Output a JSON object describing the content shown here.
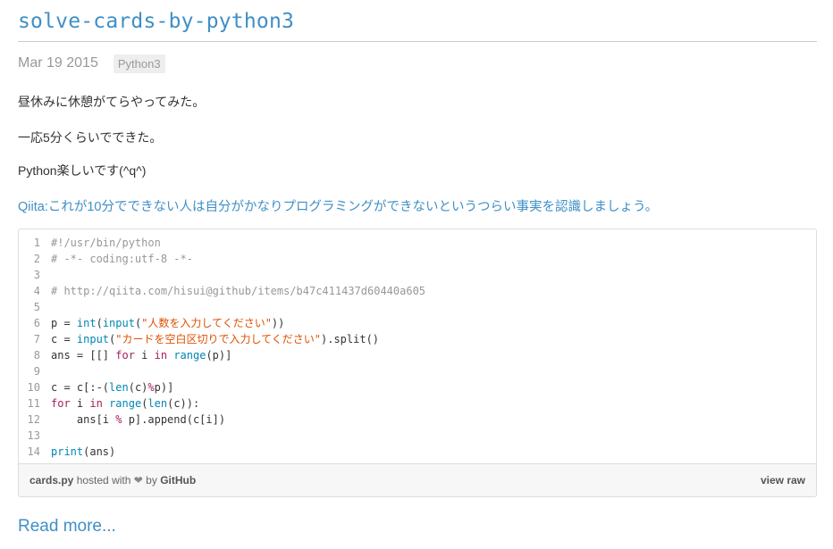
{
  "post": {
    "title": "solve-cards-by-python3",
    "date": "Mar 19 2015",
    "tag": "Python3",
    "paragraphs": [
      "昼休みに休憩がてらやってみた。",
      "一応5分くらいでできた。",
      "Python楽しいです(^q^)"
    ],
    "link_text": "Qiita:これが10分でできない人は自分がかなりプログラミングができないというつらい事実を認識しましょう。",
    "read_more": "Read more..."
  },
  "gist": {
    "file": "cards.py",
    "hosted_with": "hosted with",
    "heart": "❤",
    "by": "by",
    "github": "GitHub",
    "view_raw": "view raw",
    "line_numbers": [
      "1",
      "2",
      "3",
      "4",
      "5",
      "6",
      "7",
      "8",
      "9",
      "10",
      "11",
      "12",
      "13",
      "14"
    ],
    "lines": [
      [
        [
          "c",
          "#!/usr/bin/python"
        ]
      ],
      [
        [
          "c",
          "# -*- coding:utf-8 -*-"
        ]
      ],
      [],
      [
        [
          "c",
          "# http://qiita.com/hisui@github/items/b47c411437d60440a605"
        ]
      ],
      [],
      [
        [
          "n",
          "p = "
        ],
        [
          "b",
          "int"
        ],
        [
          "n",
          "("
        ],
        [
          "b",
          "input"
        ],
        [
          "n",
          "("
        ],
        [
          "s",
          "\"人数を入力してください\""
        ],
        [
          "n",
          "))"
        ]
      ],
      [
        [
          "n",
          "c = "
        ],
        [
          "b",
          "input"
        ],
        [
          "n",
          "("
        ],
        [
          "s",
          "\"カードを空白区切りで入力してください\""
        ],
        [
          "n",
          ").split()"
        ]
      ],
      [
        [
          "n",
          "ans = [[] "
        ],
        [
          "k",
          "for"
        ],
        [
          "n",
          " i "
        ],
        [
          "k",
          "in"
        ],
        [
          "n",
          " "
        ],
        [
          "b",
          "range"
        ],
        [
          "n",
          "(p)]"
        ]
      ],
      [],
      [
        [
          "n",
          "c = c[:-("
        ],
        [
          "b",
          "len"
        ],
        [
          "n",
          "(c)"
        ],
        [
          "k",
          "%"
        ],
        [
          "n",
          "p)]"
        ]
      ],
      [
        [
          "k",
          "for"
        ],
        [
          "n",
          " i "
        ],
        [
          "k",
          "in"
        ],
        [
          "n",
          " "
        ],
        [
          "b",
          "range"
        ],
        [
          "n",
          "("
        ],
        [
          "b",
          "len"
        ],
        [
          "n",
          "(c)):"
        ]
      ],
      [
        [
          "n",
          "    ans[i "
        ],
        [
          "k",
          "%"
        ],
        [
          "n",
          " p].append(c[i])"
        ]
      ],
      [],
      [
        [
          "b",
          "print"
        ],
        [
          "n",
          "(ans)"
        ]
      ]
    ]
  }
}
